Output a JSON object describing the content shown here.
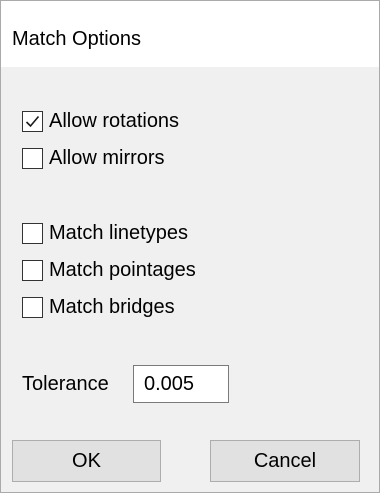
{
  "dialog": {
    "title": "Match Options",
    "options": [
      {
        "label": "Allow rotations",
        "checked": true
      },
      {
        "label": "Allow mirrors",
        "checked": false
      },
      {
        "label": "Match linetypes",
        "checked": false
      },
      {
        "label": "Match pointages",
        "checked": false
      },
      {
        "label": "Match bridges",
        "checked": false
      }
    ],
    "tolerance": {
      "label": "Tolerance",
      "value": "0.005"
    },
    "buttons": {
      "ok_label": "OK",
      "cancel_label": "Cancel"
    },
    "icons": {
      "checkmark": "checkmark-icon"
    }
  }
}
